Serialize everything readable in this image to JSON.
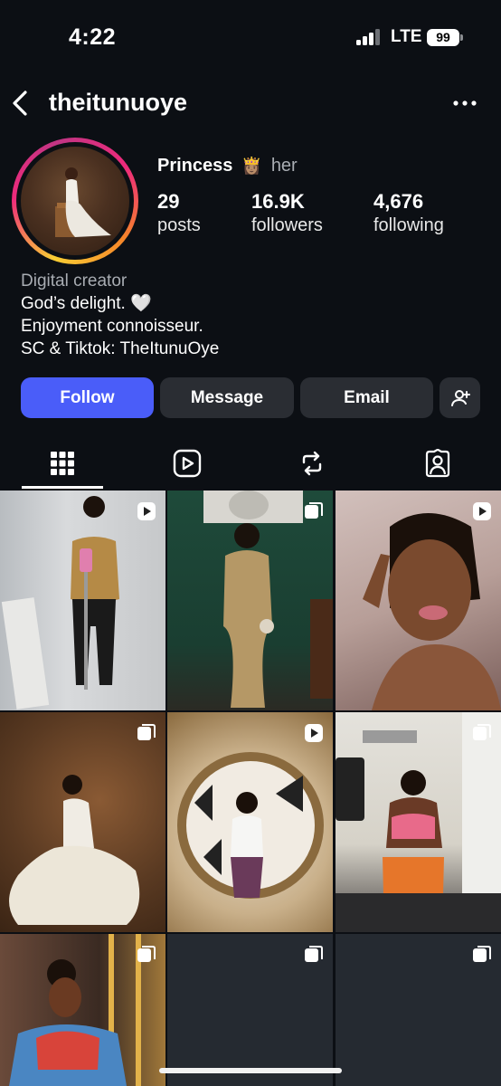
{
  "status_bar": {
    "time": "4:22",
    "network": "LTE",
    "battery": "99"
  },
  "header": {
    "username": "theitunuoye",
    "back_icon": "chevron-left-icon",
    "more_icon": "ellipsis-icon"
  },
  "profile": {
    "display_name": "Princess",
    "emoji": "👸🏽",
    "pronouns": "her",
    "stats": [
      {
        "value": "29",
        "label": "posts"
      },
      {
        "value": "16.9K",
        "label": "followers"
      },
      {
        "value": "4,676",
        "label": "following"
      }
    ],
    "bio": {
      "category": "Digital creator",
      "lines": [
        "God’s delight. 🤍",
        "Enjoyment connoisseur.",
        "SC & Tiktok: TheItunuOye"
      ]
    }
  },
  "actions": {
    "follow": "Follow",
    "message": "Message",
    "email": "Email",
    "add_user_icon": "add-user-icon"
  },
  "tabs": [
    {
      "name": "posts",
      "icon": "grid-icon",
      "selected": true
    },
    {
      "name": "reels",
      "icon": "reels-icon",
      "selected": false
    },
    {
      "name": "reposts",
      "icon": "repost-icon",
      "selected": false
    },
    {
      "name": "tagged",
      "icon": "tagged-icon",
      "selected": false
    }
  ],
  "grid": [
    {
      "type": "reel",
      "badge_icon": "reel-icon"
    },
    {
      "type": "carousel",
      "badge_icon": "carousel-icon"
    },
    {
      "type": "reel",
      "badge_icon": "reel-icon"
    },
    {
      "type": "carousel",
      "badge_icon": "carousel-icon"
    },
    {
      "type": "reel",
      "badge_icon": "reel-icon"
    },
    {
      "type": "carousel",
      "badge_icon": "carousel-icon"
    },
    {
      "type": "carousel",
      "badge_icon": "carousel-icon"
    },
    {
      "type": "carousel",
      "badge_icon": "carousel-icon"
    },
    {
      "type": "carousel",
      "badge_icon": "carousel-icon"
    }
  ],
  "colors": {
    "background": "#0c0f14",
    "follow_button": "#4a5df9",
    "secondary_button": "#2a2d33",
    "muted_text": "#a8acb2"
  }
}
